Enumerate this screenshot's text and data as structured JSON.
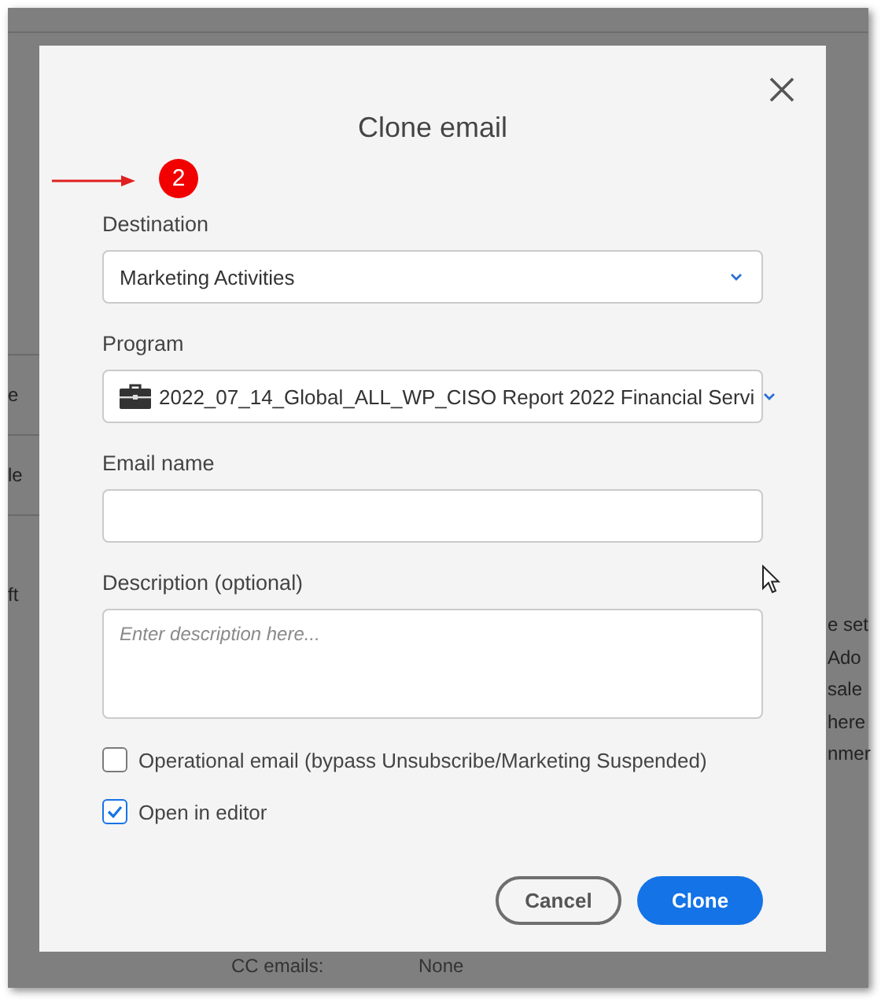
{
  "background": {
    "left_texts": [
      "e",
      "le",
      "ft"
    ],
    "right_texts": [
      "e set",
      "Ado",
      "sale",
      "here",
      "nmer"
    ],
    "details": [
      {
        "label": "CC emails:",
        "value": "None"
      }
    ]
  },
  "annotation": {
    "step": "2"
  },
  "dialog": {
    "title": "Clone email",
    "fields": [
      {
        "kind": "select",
        "label": "Destination",
        "value": "Marketing Activities"
      },
      {
        "kind": "program",
        "label": "Program",
        "value": "2022_07_14_Global_ALL_WP_CISO Report 2022 Financial Servi"
      },
      {
        "kind": "text",
        "label": "Email name"
      },
      {
        "kind": "textarea",
        "label": "Description (optional)",
        "placeholder": "Enter description here..."
      }
    ],
    "checkboxes": [
      {
        "label": "Operational email (bypass Unsubscribe/Marketing Suspended)",
        "checked": false
      },
      {
        "label": "Open in editor",
        "checked": true
      }
    ],
    "buttons": [
      {
        "kind": "secondary",
        "label": "Cancel"
      },
      {
        "kind": "primary",
        "label": "Clone"
      }
    ]
  }
}
